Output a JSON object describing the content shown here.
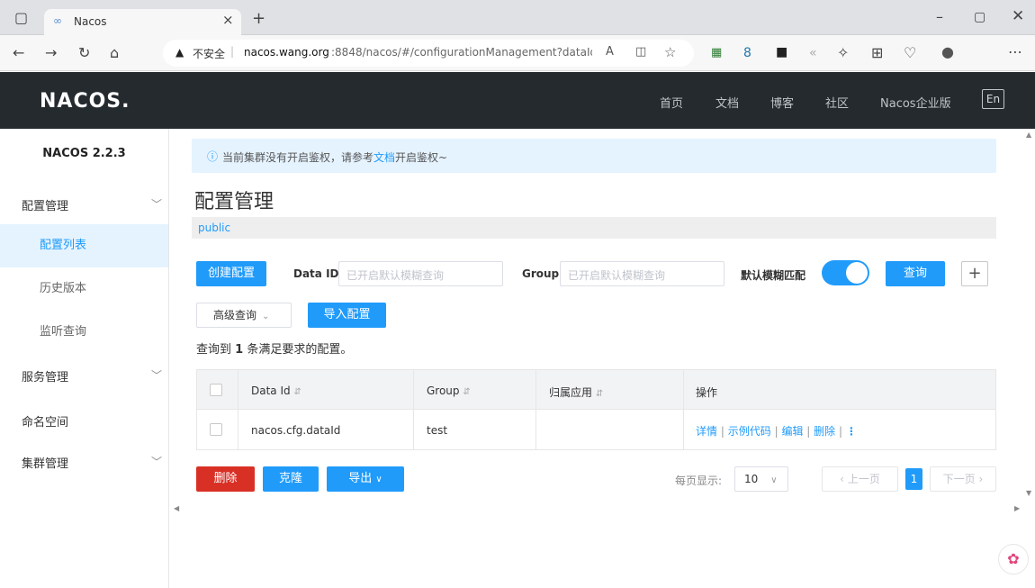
{
  "browser": {
    "tab_title": "Nacos",
    "url_warning": "不安全",
    "url_host": "nacos.wang.org",
    "url_rest": ":8848/nacos/#/configurationManagement?dataId..."
  },
  "header": {
    "logo": "NACOS.",
    "nav": [
      "首页",
      "文档",
      "博客",
      "社区",
      "Nacos企业版"
    ],
    "lang_button": "En"
  },
  "sidebar": {
    "version": "NACOS 2.2.3",
    "groups": [
      {
        "label": "配置管理",
        "items": [
          "配置列表",
          "历史版本",
          "监听查询"
        ]
      },
      {
        "label": "服务管理"
      },
      {
        "label": "命名空间"
      },
      {
        "label": "集群管理"
      }
    ]
  },
  "notice": {
    "prefix": "当前集群没有开启鉴权，请参考",
    "link": "文档",
    "suffix": "开启鉴权~"
  },
  "page": {
    "title": "配置管理",
    "namespace": "public"
  },
  "toolbar": {
    "create": "创建配置",
    "dataid_label": "Data ID",
    "dataid_placeholder": "已开启默认模糊查询",
    "group_label": "Group",
    "group_placeholder": "已开启默认模糊查询",
    "fuzzy_label": "默认模糊匹配",
    "query": "查询",
    "plus": "+",
    "advanced": "高级查询",
    "import": "导入配置"
  },
  "result": {
    "pre": "查询到 ",
    "count": "1",
    "post": " 条满足要求的配置。"
  },
  "table": {
    "headers": [
      "Data Id",
      "Group",
      "归属应用",
      "操作"
    ],
    "rows": [
      {
        "data_id": "nacos.cfg.dataId",
        "group": "test",
        "app": "",
        "ops": [
          "详情",
          "示例代码",
          "编辑",
          "删除"
        ]
      }
    ]
  },
  "footer": {
    "delete": "删除",
    "clone": "克隆",
    "export": "导出",
    "per_page_label": "每页显示:",
    "per_page": "10",
    "prev": "上一页",
    "page": "1",
    "next": "下一页"
  },
  "colors": {
    "primary": "#209bfa",
    "danger": "#d93026",
    "header_bg": "#252a2f"
  }
}
